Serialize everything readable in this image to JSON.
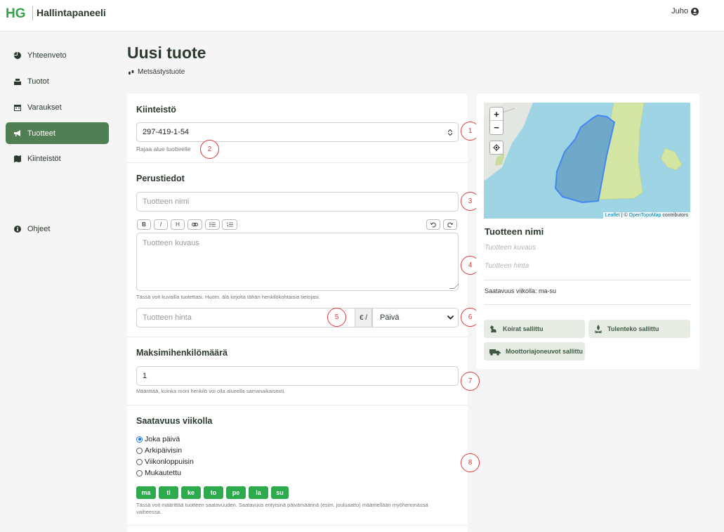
{
  "header": {
    "title": "Hallintapaneeli",
    "user": "Juho",
    "logo_text": "HG"
  },
  "sidebar": {
    "items": [
      {
        "label": "Yhteenveto",
        "icon": "pie-chart-icon",
        "active": false
      },
      {
        "label": "Tuotot",
        "icon": "cash-register-icon",
        "active": false
      },
      {
        "label": "Varaukset",
        "icon": "calendar-icon",
        "active": false
      },
      {
        "label": "Tuotteet",
        "icon": "megaphone-icon",
        "active": true
      },
      {
        "label": "Kiinteistöt",
        "icon": "map-icon",
        "active": false
      },
      {
        "label": "Ohjeet",
        "icon": "info-icon",
        "active": false
      }
    ]
  },
  "page": {
    "title": "Uusi tuote",
    "subtitle": "Metsästystuote"
  },
  "form": {
    "property": {
      "title": "Kiinteistö",
      "value": "297-419-1-54",
      "hint": "Rajaa alue tuotteelle"
    },
    "basic": {
      "title": "Perustiedot",
      "name_placeholder": "Tuotteen nimi",
      "toolbar": [
        "B",
        "I",
        "H"
      ],
      "description_placeholder": "Tuotteen kuvaus",
      "description_hint": "Tässä voit kuvailla tuotettasi. Huom. älä kirjoita tähän henkilökohtaisia tietojasi.",
      "price_placeholder": "Tuotteen hinta",
      "price_unit": "€ /",
      "period": "Päivä"
    },
    "capacity": {
      "title": "Maksimihenkilömäärä",
      "value": "1",
      "hint": "Määrittää, kuinka moni henkilö voi olla alueella samanaikaisesti."
    },
    "availability": {
      "title": "Saatavuus viikolla",
      "options": [
        "Joka päivä",
        "Arkipäivisin",
        "Viikonloppuisin",
        "Mukautettu"
      ],
      "selected": "Joka päivä",
      "days": [
        "ma",
        "ti",
        "ke",
        "to",
        "pe",
        "la",
        "su"
      ],
      "hint_line1": "Tässä voit määrittää tuotteen saatavuuden. Saatavuus erityisinä päivämäärinä (esim. jouluaatto) määritellään myöhemmässä",
      "hint_line2": "vaiheessa."
    }
  },
  "badges": [
    "1",
    "2",
    "3",
    "4",
    "5",
    "6",
    "7",
    "8"
  ],
  "preview": {
    "title": "Tuotteen nimi",
    "description_placeholder": "Tuotteen kuvaus",
    "price_placeholder": "Tuotteen hinta",
    "availability": "Saatavuus viikolla: ma-su",
    "map": {
      "zoom_in": "+",
      "zoom_out": "−",
      "attribution_leaflet": "Leaflet",
      "attribution_sep": " | © ",
      "attribution_otm": "OpenTopoMap",
      "attribution_tail": " contributors"
    },
    "tags": [
      {
        "label": "Koirat sallittu",
        "icon": "dog-icon"
      },
      {
        "label": "Tulenteko sallittu",
        "icon": "campfire-icon"
      },
      {
        "label": "Moottoriajoneuvot sallittu",
        "icon": "truck-icon"
      }
    ]
  },
  "colors": {
    "primary": "#4f7f52",
    "day_button": "#2daa4c",
    "badge": "#e03a3a"
  }
}
